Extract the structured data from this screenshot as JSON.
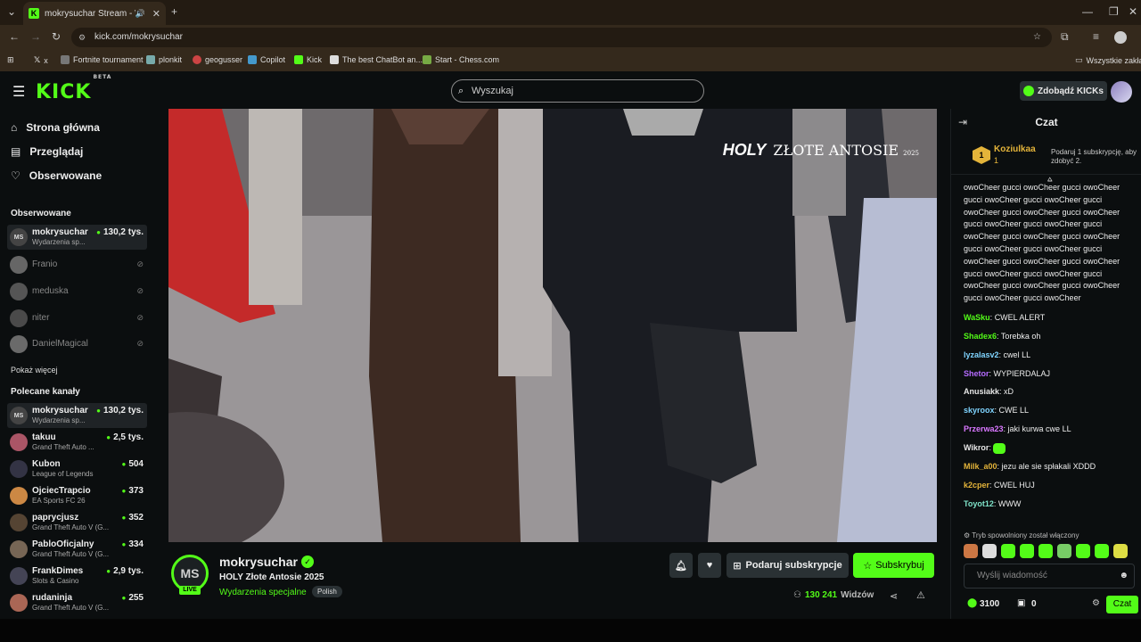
{
  "browser": {
    "tab_title": "mokrysuchar Stream - Wat",
    "url": "kick.com/mokrysuchar",
    "bookmarks": [
      "x",
      "Fortnite tournament",
      "plonkit",
      "geogusser",
      "Copilot",
      "Kick",
      "The best ChatBot an...",
      "Start - Chess.com",
      "Wszystkie zakład"
    ]
  },
  "header": {
    "logo": "KICK",
    "logo_sup": "BETA",
    "search_placeholder": "Wyszukaj",
    "get_kicks": "Zdobądź KICKs"
  },
  "sidebar": {
    "nav": [
      "Strona główna",
      "Przeglądaj",
      "Obserwowane"
    ],
    "followed_title": "Obserwowane",
    "followed": [
      {
        "name": "mokrysuchar",
        "category": "Wydarzenia sp...",
        "viewers": "130,2 tys.",
        "avatar": "MS"
      }
    ],
    "offline": [
      "Franio",
      "meduska",
      "niter",
      "DanielMagical"
    ],
    "show_more": "Pokaż więcej",
    "recommended_title": "Polecane kanały",
    "recommended": [
      {
        "name": "mokrysuchar",
        "category": "Wydarzenia sp...",
        "viewers": "130,2 tys.",
        "avatar": "MS"
      },
      {
        "name": "takuu",
        "category": "Grand Theft Auto ...",
        "viewers": "2,5 tys."
      },
      {
        "name": "Kubon",
        "category": "League of Legends",
        "viewers": "504"
      },
      {
        "name": "OjciecTrapcio",
        "category": "EA Sports FC 26",
        "viewers": "373"
      },
      {
        "name": "paprycjusz",
        "category": "Grand Theft Auto V (G...",
        "viewers": "352"
      },
      {
        "name": "PabloOficjalny",
        "category": "Grand Theft Auto V (G...",
        "viewers": "334"
      },
      {
        "name": "FrankDimes",
        "category": "Slots & Casino",
        "viewers": "2,9 tys."
      },
      {
        "name": "rudaninja",
        "category": "Grand Theft Auto V (G...",
        "viewers": "255"
      }
    ]
  },
  "video": {
    "watermark_main": "HOLY",
    "watermark_sub": "ZŁOTE ANTOSIE",
    "watermark_year": "2025"
  },
  "stream": {
    "avatar": "MS",
    "live": "LIVE",
    "name": "mokrysuchar",
    "title": "HOLY Złote Antosie 2025",
    "category": "Wydarzenia specjalne",
    "language": "Polish",
    "gift_sub": "Podaruj subskrypcje",
    "subscribe": "Subskrybuj",
    "viewer_count": "130 241",
    "viewer_label": "Widzów"
  },
  "chat": {
    "title": "Czat",
    "pinned": {
      "name": "Koziulkaa",
      "count": "1",
      "text": "Podaruj 1 subskrypcję, aby zdobyć 2."
    },
    "spam": "owoCheer gucci owoCheer gucci owoCheer gucci owoCheer gucci owoCheer gucci owoCheer gucci owoCheer gucci owoCheer gucci owoCheer gucci owoCheer gucci owoCheer gucci owoCheer gucci owoCheer gucci owoCheer gucci owoCheer gucci owoCheer gucci owoCheer gucci owoCheer gucci owoCheer gucci owoCheer gucci owoCheer gucci owoCheer gucci owoCheer gucci owoCheer gucci owoCheer",
    "messages": [
      {
        "user": "WaSku",
        "text": "CWEL ALERT",
        "color": "#53fc18"
      },
      {
        "user": "Shadex6",
        "text": "Torebka oh",
        "color": "#53fc18"
      },
      {
        "user": "lyzalasv2",
        "text": "cwel LL",
        "color": "#7fd4ff"
      },
      {
        "user": "Shetor",
        "text": "WYPIERDALAJ",
        "color": "#b56bff"
      },
      {
        "user": "Anusiakk",
        "text": "xD",
        "color": "#e8e8e8"
      },
      {
        "user": "skyroox",
        "text": "CWE LL",
        "color": "#7fd4ff"
      },
      {
        "user": "Przerwa23",
        "text": "jaki kurwa cwe LL",
        "color": "#d977ff"
      },
      {
        "user": "Wikror",
        "text": "",
        "color": "#e8e8e8"
      },
      {
        "user": "Milk_a00",
        "text": "jezu ale sie spłakali XDDD",
        "color": "#e4b43a"
      },
      {
        "user": "k2cper",
        "text": "CWEL HUJ",
        "color": "#e4b43a"
      },
      {
        "user": "Toyot12",
        "text": "WWW",
        "color": "#7fe3c9"
      }
    ],
    "slow_mode": "Tryb spowolniony został włączony",
    "input_placeholder": "Wyślij wiadomość",
    "kicks": "3100",
    "points": "0",
    "send": "Czat"
  }
}
